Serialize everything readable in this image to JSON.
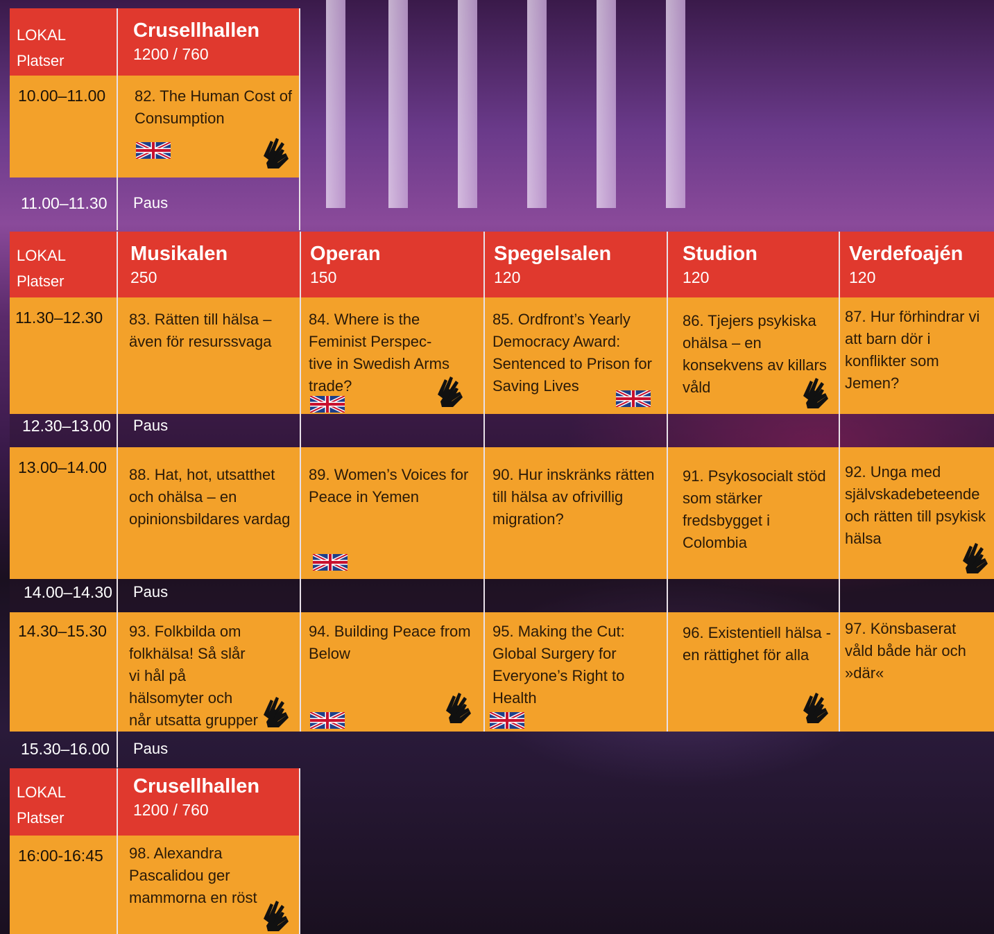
{
  "colors": {
    "header": "#e0392e",
    "session": "#f3a12a",
    "divider": "#e8e0e8"
  },
  "top": {
    "lokal_label": "LOKAL",
    "platser_label": "Platser",
    "venue": "Crusellhallen",
    "seats": "1200 / 760",
    "time": "10.00–11.00",
    "event": "82. The Human Cost of Consumption",
    "pause_time": "11.00–11.30",
    "pause_label": "Paus"
  },
  "main": {
    "lokal_label": "LOKAL",
    "platser_label": "Platser",
    "venues": [
      {
        "name": "Musikalen",
        "seats": "250"
      },
      {
        "name": "Operan",
        "seats": "150"
      },
      {
        "name": "Spegelsalen",
        "seats": "120"
      },
      {
        "name": "Studion",
        "seats": "120"
      },
      {
        "name": "Verdefoajén",
        "seats": "120"
      }
    ],
    "slot1": {
      "time": "11.30–12.30",
      "events": [
        "83. Rätten till hälsa – även för resurssvaga",
        "84. Where is the Feminist Perspec-tive in Swedish Arms trade?",
        "85. Ordfront’s Yearly Democracy Award: Sentenced to Prison for Saving Lives",
        "86. Tjejers psykiska ohälsa – en konsekvens av killars våld",
        "87. Hur förhindrar vi att barn dör i konflikter som Jemen?"
      ]
    },
    "pause1": {
      "time": "12.30–13.00",
      "label": "Paus"
    },
    "slot2": {
      "time": "13.00–14.00",
      "events": [
        "88. Hat, hot, utsatthet och ohälsa – en opinionsbildares vardag",
        "89. Women’s Voices for Peace in Yemen",
        "90. Hur inskränks rätten till hälsa av ofrivillig migration?",
        "91. Psykosocialt stöd som stärker fredsbygget i Colombia",
        "92. Unga med självskadebeteende och rätten till psykisk hälsa"
      ]
    },
    "pause2": {
      "time": "14.00–14.30",
      "label": "Paus"
    },
    "slot3": {
      "time": "14.30–15.30",
      "events": [
        "93. Folkbilda om folkhälsa! Så slår vi hål på hälsomyter och når utsatta grupper",
        "94. Building Peace from Below",
        "95. Making the Cut: Global Surgery for Everyone’s Right to Health",
        "96. Existentiell hälsa - en rättighet för alla",
        "97. Könsbaserat våld både här och »där«"
      ]
    },
    "pause3": {
      "time": "15.30–16.00",
      "label": "Paus"
    }
  },
  "bottom": {
    "lokal_label": "LOKAL",
    "platser_label": "Platser",
    "venue": "Crusellhallen",
    "seats": "1200 / 760",
    "time": "16:00-16:45",
    "event": "98. Alexandra Pascalidou ger mammorna en röst"
  },
  "icons": {
    "english": "uk-flag-icon",
    "sign_language": "sign-language-icon"
  }
}
